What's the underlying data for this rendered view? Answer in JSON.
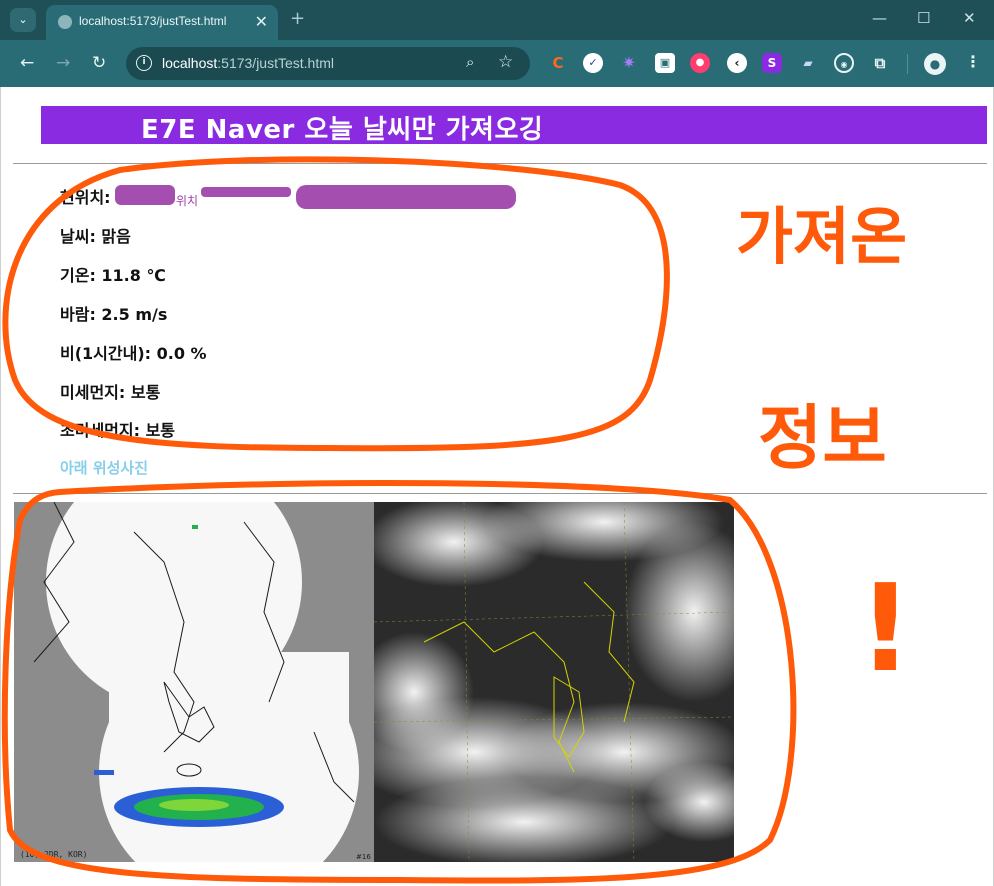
{
  "browser": {
    "tab_title": "localhost:5173/justTest.html",
    "new_tab_symbol": "+",
    "url_host": "localhost",
    "url_path": ":5173/justTest.html",
    "window_controls": {
      "minimize": "—",
      "maximize": "☐",
      "close": "✕"
    }
  },
  "page": {
    "banner_title": "E7E Naver 오늘 날씨만 가져오깅",
    "location_label": "현위치:",
    "location_tail": "위치",
    "weather": "날씨: 맑음",
    "temperature": "기온: 11.8 ℃",
    "wind": "바람: 2.5 m/s",
    "rain": "비(1시간내): 0.0 %",
    "fine_dust": "미세먼지: 보통",
    "ultra_fine_dust": "초미세먼지: 보통",
    "satellite_link": "아래 위성사진",
    "radar_caption": "(10, 2DR, KOR)",
    "satellite_caption": "#16"
  },
  "annotation": {
    "line1": "가져온",
    "line2": "정보",
    "mark": "!"
  },
  "colors": {
    "banner": "#8a2be2",
    "link": "#87ceeb",
    "annotation": "#ff5a0a",
    "redaction": "#9c3fa8"
  }
}
